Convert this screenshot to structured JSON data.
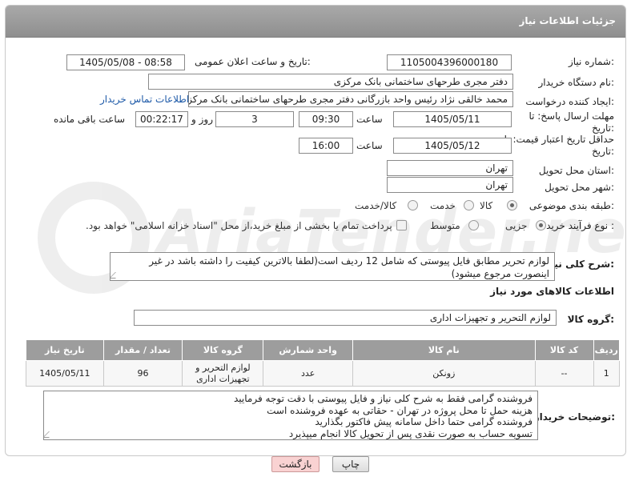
{
  "panel": {
    "title": "جزئیات اطلاعات نیاز"
  },
  "watermark": {
    "text": "AriaTender.net"
  },
  "fields": {
    "need_number": {
      "label": "شماره نیاز:",
      "value": "1105004396000180"
    },
    "announce_datetime": {
      "label": "تاریخ و ساعت اعلان عمومی:",
      "value": "1405/05/08 - 08:58"
    },
    "buyer_org": {
      "label": "نام دستگاه خریدار:",
      "value": "دفتر مجری طرحهای ساختمانی بانک مرکزی"
    },
    "requester": {
      "label": "ایجاد کننده درخواست:",
      "value": "محمد خالقی نژاد رئیس واحد بازرگانی دفتر مجری طرحهای ساختمانی بانک مرکزی",
      "contact_link": "اطلاعات تماس خریدار"
    },
    "deadline": {
      "label": "مهلت ارسال پاسخ: تا تاریخ:",
      "date": "1405/05/11",
      "time_label": "ساعت",
      "time": "09:30",
      "days": "3",
      "days_label": "روز و",
      "remaining": "00:22:17",
      "remaining_label": "ساعت باقی مانده"
    },
    "price_validity": {
      "label": "حداقل تاریخ اعتبار قیمت: تا تاریخ:",
      "date": "1405/05/12",
      "time_label": "ساعت",
      "time": "16:00"
    },
    "province": {
      "label": "استان محل تحویل:",
      "value": "تهران"
    },
    "city": {
      "label": "شهر محل تحویل:",
      "value": "تهران"
    },
    "category": {
      "label": "طبقه بندی موضوعی:",
      "options": [
        "کالا",
        "خدمت",
        "کالا/خدمت"
      ],
      "selected": "کالا"
    },
    "purchase_process": {
      "label": "نوع فرآیند خرید :",
      "options": [
        "جزیی",
        "متوسط"
      ],
      "selected": "جزیی",
      "payment_note": "پرداخت تمام یا بخشی از مبلغ خرید،از محل \"اسناد خزانه اسلامی\" خواهد بود."
    }
  },
  "description": {
    "label": "شرح کلی نیاز:",
    "text": "لوازم تحریر مطابق فایل پیوستی که شامل 12 ردیف است(لطفا بالاترین کیفیت را داشته باشد در غیر اینصورت مرجوع میشود)"
  },
  "goods": {
    "section_title": "اطلاعات کالاهای مورد نیاز",
    "group_label": "گروه کالا:",
    "group_value": "لوازم التحریر و تجهیزات اداری",
    "columns": [
      "ردیف",
      "کد کالا",
      "نام کالا",
      "واحد شمارش",
      "گروه کالا",
      "تعداد / مقدار",
      "تاریخ نیاز"
    ],
    "rows": [
      {
        "row": "1",
        "code": "--",
        "name": "زونکن",
        "unit": "عدد",
        "group": "لوازم التحریر و تجهیزات اداری",
        "qty": "96",
        "date": "1405/05/11"
      }
    ]
  },
  "buyer_notes": {
    "label": "توضیحات خریدار:",
    "lines": [
      "فروشنده گرامی فقط به شرح کلی نیاز و فایل پیوستی با دقت توجه فرمایید",
      "هزینه حمل تا محل پروژه در تهران - حقاتی به عهده فروشنده است",
      "فروشنده گرامی حتما داخل سامانه پیش فاکتور بگذارید",
      "تسویه حساب به صورت نقدی پس از تحویل کالا  انجام میپذیرد"
    ]
  },
  "buttons": {
    "print": "چاپ",
    "back": "بازگشت"
  }
}
